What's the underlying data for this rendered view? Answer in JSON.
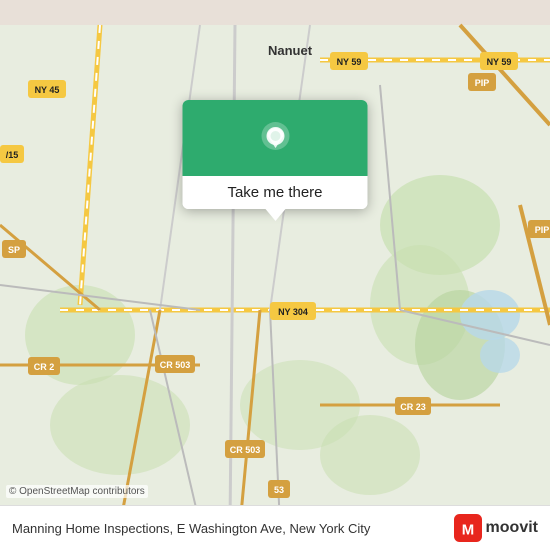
{
  "map": {
    "background_color": "#e8e0d8",
    "attribution": "© OpenStreetMap contributors"
  },
  "popup": {
    "button_label": "Take me there",
    "pin_color": "#2eab6e"
  },
  "bottom_bar": {
    "address": "Manning Home Inspections, E Washington Ave, New York City",
    "logo_text": "moovit"
  },
  "road_labels": [
    {
      "id": "ny45",
      "text": "NY 45"
    },
    {
      "id": "ny59a",
      "text": "NY 59"
    },
    {
      "id": "ny59b",
      "text": "NY 59"
    },
    {
      "id": "nanuet",
      "text": "Nanuet"
    },
    {
      "id": "pip_top",
      "text": "PIP"
    },
    {
      "id": "pip_mid",
      "text": "PIP"
    },
    {
      "id": "sp",
      "text": "SP"
    },
    {
      "id": "cr2",
      "text": "CR 2"
    },
    {
      "id": "cr503a",
      "text": "CR 503"
    },
    {
      "id": "ny304",
      "text": "NY 304"
    },
    {
      "id": "cr23",
      "text": "CR 23"
    },
    {
      "id": "cr503b",
      "text": "CR 503"
    },
    {
      "id": "s53",
      "text": "53"
    }
  ]
}
